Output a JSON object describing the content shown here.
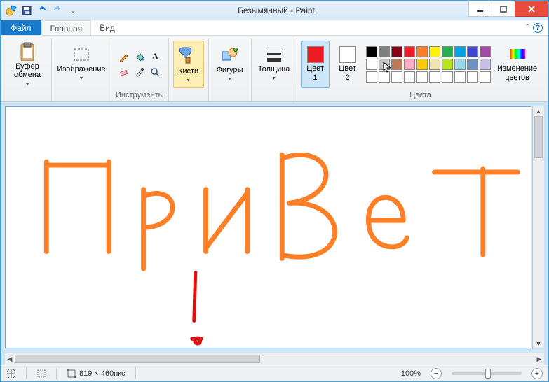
{
  "title": "Безымянный - Paint",
  "qat": {
    "save": "save-icon",
    "undo": "undo-icon",
    "redo": "redo-icon"
  },
  "menus": {
    "file": "Файл",
    "home": "Главная",
    "view": "Вид"
  },
  "ribbon_help": "?",
  "groups": {
    "clipboard": {
      "btn": "Буфер\nобмена",
      "label": ""
    },
    "image": {
      "btn": "Изображение",
      "label": ""
    },
    "tools": {
      "label": "Инструменты"
    },
    "brushes": {
      "btn": "Кисти"
    },
    "shapes": {
      "btn": "Фигуры"
    },
    "size": {
      "btn": "Толщина"
    },
    "color1": {
      "btn": "Цвет\n1"
    },
    "color2": {
      "btn": "Цвет\n2"
    },
    "colors_label": "Цвета",
    "edit_colors": {
      "btn": "Изменение\nцветов"
    }
  },
  "colors": {
    "color1": "#ed1c24",
    "color2": "#ffffff",
    "palette": [
      "#000000",
      "#7f7f7f",
      "#880015",
      "#ed1c24",
      "#ff7f27",
      "#fff200",
      "#22b14c",
      "#00a2e8",
      "#3f48cc",
      "#a349a4",
      "#ffffff",
      "#c3c3c3",
      "#b97a57",
      "#ffaec9",
      "#ffc90e",
      "#efe4b0",
      "#b5e61d",
      "#99d9ea",
      "#7092be",
      "#c8bfe7",
      "#ffffff",
      "#ffffff",
      "#ffffff",
      "#ffffff",
      "#ffffff",
      "#ffffff",
      "#ffffff",
      "#ffffff",
      "#ffffff",
      "#ffffff"
    ]
  },
  "status": {
    "dimensions": "819 × 460пкс",
    "zoom": "100%"
  }
}
